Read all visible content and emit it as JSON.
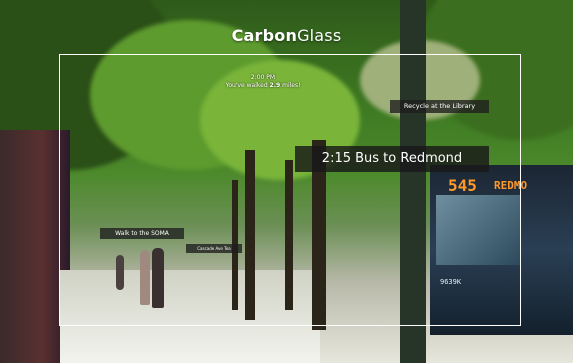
{
  "brand": {
    "name_bold": "Carbon",
    "name_regular": "Glass"
  },
  "status": {
    "time": "2:00 PM",
    "walked_prefix": "You've walked ",
    "walked_value": "2.9",
    "walked_suffix": " miles!"
  },
  "notifications": {
    "recycle": "Recycle at the Library",
    "bus": "2:15 Bus to Redmond",
    "soma": "Walk to the SOMA",
    "small": "Cascade Ave Tea"
  },
  "scene": {
    "bus_sign_number": "545",
    "bus_sign_dest": "REDMO",
    "bus_plate": "9639K"
  },
  "colors": {
    "frame": "#ffffff",
    "tag_bg": "#1e1e1e",
    "led": "#ff9a2a"
  }
}
